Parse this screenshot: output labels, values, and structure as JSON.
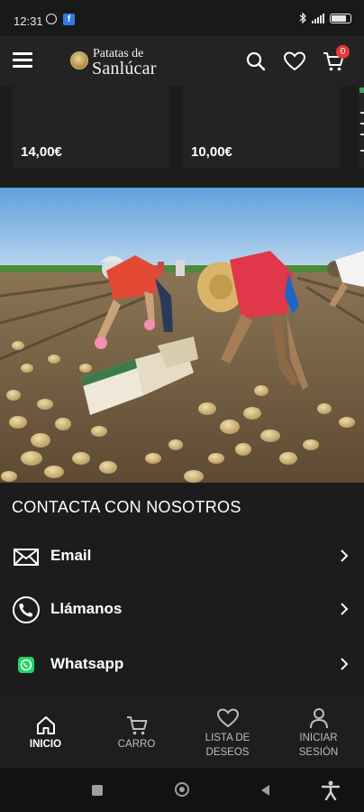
{
  "status_bar": {
    "time": "12:31",
    "icons": [
      "alarm-icon",
      "facebook-icon",
      "bluetooth-icon",
      "signal-icon",
      "battery-icon"
    ],
    "battery_level": 0.9
  },
  "header": {
    "logo_line1": "Patatas de",
    "logo_line2": "Sanlúcar",
    "cart_count": "0",
    "icons": [
      "menu-icon",
      "search-icon",
      "heart-icon",
      "cart-icon"
    ]
  },
  "products": [
    {
      "price": "14,00€"
    },
    {
      "price": "10,00€"
    }
  ],
  "contact": {
    "title": "CONTACTA CON NOSOTROS",
    "items": [
      {
        "label": "Email",
        "icon": "mail-icon"
      },
      {
        "label": "Llámanos",
        "icon": "phone-icon"
      },
      {
        "label": "Whatsapp",
        "icon": "whatsapp-icon"
      }
    ]
  },
  "bottom_nav": [
    {
      "label_line1": "INICIO",
      "label_line2": "",
      "icon": "home-icon",
      "active": true
    },
    {
      "label_line1": "CARRO",
      "label_line2": "",
      "icon": "cart-icon",
      "active": false
    },
    {
      "label_line1": "LISTA DE",
      "label_line2": "DESEOS",
      "icon": "heart-icon",
      "active": false
    },
    {
      "label_line1": "INICIAR",
      "label_line2": "SESIÓN",
      "icon": "user-icon",
      "active": false
    }
  ],
  "colors": {
    "background": "#1c1c1c",
    "surface": "#232323",
    "badge": "#e53935",
    "whatsapp": "#25d366"
  }
}
